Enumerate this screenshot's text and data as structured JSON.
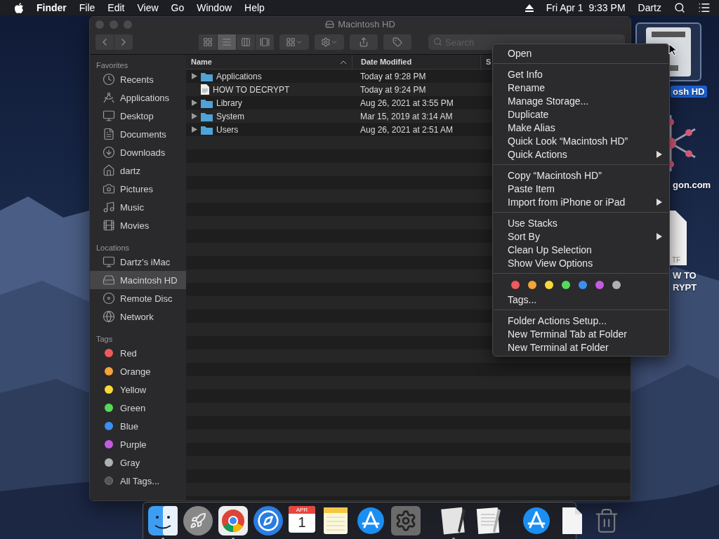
{
  "menu_bar": {
    "app_name": "Finder",
    "menus": [
      "File",
      "Edit",
      "View",
      "Go",
      "Window",
      "Help"
    ],
    "clock": "Fri Apr 1  9:33 PM",
    "user": "Dartz"
  },
  "window": {
    "title": "Macintosh HD",
    "search": {
      "placeholder": "Search"
    },
    "view_buttons": [
      {
        "kind": "icons",
        "selected": false
      },
      {
        "kind": "list",
        "selected": true
      },
      {
        "kind": "columns",
        "selected": false
      },
      {
        "kind": "gallery",
        "selected": false
      }
    ],
    "sidebar": [
      {
        "heading": "Favorites",
        "items": [
          {
            "label": "Recents",
            "selected": false
          },
          {
            "label": "Applications",
            "selected": false
          },
          {
            "label": "Desktop",
            "selected": false
          },
          {
            "label": "Documents",
            "selected": false
          },
          {
            "label": "Downloads",
            "selected": false
          },
          {
            "label": "dartz",
            "selected": false
          },
          {
            "label": "Pictures",
            "selected": false
          },
          {
            "label": "Music",
            "selected": false
          },
          {
            "label": "Movies",
            "selected": false
          }
        ]
      },
      {
        "heading": "Locations",
        "items": [
          {
            "label": "Dartz’s iMac",
            "selected": false
          },
          {
            "label": "Macintosh HD",
            "selected": true
          },
          {
            "label": "Remote Disc",
            "selected": false
          },
          {
            "label": "Network",
            "selected": false
          }
        ]
      },
      {
        "heading": "Tags",
        "items": [
          {
            "label": "Red",
            "kind": "tag",
            "color": "#ee5a5a",
            "selected": false
          },
          {
            "label": "Orange",
            "kind": "tag",
            "color": "#f5a33a",
            "selected": false
          },
          {
            "label": "Yellow",
            "kind": "tag",
            "color": "#f7d93a",
            "selected": false
          },
          {
            "label": "Green",
            "kind": "tag",
            "color": "#55d95a",
            "selected": false
          },
          {
            "label": "Blue",
            "kind": "tag",
            "color": "#3b8ff0",
            "selected": false
          },
          {
            "label": "Purple",
            "kind": "tag",
            "color": "#c55be0",
            "selected": false
          },
          {
            "label": "Gray",
            "kind": "tag",
            "color": "#b0b0b2",
            "selected": false
          },
          {
            "label": "All Tags...",
            "kind": "all_tags",
            "selected": false
          }
        ]
      }
    ],
    "table": {
      "columns": [
        "Name",
        "Date Modified",
        "S"
      ],
      "rows": [
        {
          "name": "Applications",
          "kind": "folder",
          "date": "Today at 9:28 PM",
          "expanded": false
        },
        {
          "name": "HOW TO DECRYPT",
          "kind": "file",
          "date": "Today at 9:24 PM"
        },
        {
          "name": "Library",
          "kind": "folder",
          "date": "Aug 26, 2021 at 3:55 PM",
          "expanded": false
        },
        {
          "name": "System",
          "kind": "folder",
          "date": "Mar 15, 2019 at 3:14 AM",
          "expanded": false
        },
        {
          "name": "Users",
          "kind": "folder",
          "date": "Aug 26, 2021 at 2:51 AM",
          "expanded": false
        }
      ]
    }
  },
  "context_menu": {
    "groups": [
      {
        "items": [
          {
            "label": "Open",
            "submenu": false
          }
        ]
      },
      {
        "items": [
          {
            "label": "Get Info",
            "submenu": false
          },
          {
            "label": "Rename",
            "submenu": false
          },
          {
            "label": "Manage Storage...",
            "submenu": false
          },
          {
            "label": "Duplicate",
            "submenu": false
          },
          {
            "label": "Make Alias",
            "submenu": false
          },
          {
            "label": "Quick Look “Macintosh HD”",
            "submenu": false
          },
          {
            "label": "Quick Actions",
            "submenu": true
          }
        ]
      },
      {
        "items": [
          {
            "label": "Copy “Macintosh HD”",
            "submenu": false
          },
          {
            "label": "Paste Item",
            "submenu": false
          },
          {
            "label": "Import from iPhone or iPad",
            "submenu": true
          }
        ]
      },
      {
        "items": [
          {
            "label": "Use Stacks",
            "submenu": false
          },
          {
            "label": "Sort By",
            "submenu": true
          },
          {
            "label": "Clean Up Selection",
            "submenu": false
          },
          {
            "label": "Show View Options",
            "submenu": false
          }
        ]
      },
      {
        "tag_colors": [
          {
            "color": "#ee5a5a"
          },
          {
            "color": "#f5a33a"
          },
          {
            "color": "#f7d93a"
          },
          {
            "color": "#55d95a"
          },
          {
            "color": "#3b8ff0"
          },
          {
            "color": "#c55be0"
          },
          {
            "color": "#b0b0b2"
          }
        ],
        "items": [
          {
            "label": "Tags...",
            "submenu": false
          }
        ]
      },
      {
        "items": [
          {
            "label": "Folder Actions Setup...",
            "submenu": false
          },
          {
            "label": "New Terminal Tab at Folder",
            "submenu": false
          },
          {
            "label": "New Terminal at Folder",
            "submenu": false
          }
        ]
      }
    ]
  },
  "desktop_icons": [
    {
      "kind": "drive",
      "label_lines": [
        "osh HD"
      ],
      "selected": true
    },
    {
      "kind": "emblem",
      "label_lines": [
        "gon.com"
      ],
      "selected": false
    },
    {
      "kind": "document",
      "file_type": "TF",
      "label_lines": [
        "W TO",
        "RYPT"
      ],
      "selected": false
    }
  ],
  "dock": [
    {
      "kind": "finder",
      "running": true
    },
    {
      "kind": "launchpad",
      "running": false
    },
    {
      "kind": "chrome",
      "running": true
    },
    {
      "kind": "safari",
      "running": false
    },
    {
      "kind": "calendar",
      "month": "APR",
      "day": "1",
      "running": false
    },
    {
      "kind": "notes",
      "running": false
    },
    {
      "kind": "appstore",
      "running": false
    },
    {
      "kind": "preferences",
      "running": false
    },
    {
      "kind": "separator"
    },
    {
      "kind": "preview",
      "running": true
    },
    {
      "kind": "textedit",
      "running": false
    },
    {
      "kind": "separator"
    },
    {
      "kind": "appstore",
      "running": false
    },
    {
      "kind": "file",
      "running": false
    },
    {
      "kind": "trash",
      "running": false
    }
  ]
}
